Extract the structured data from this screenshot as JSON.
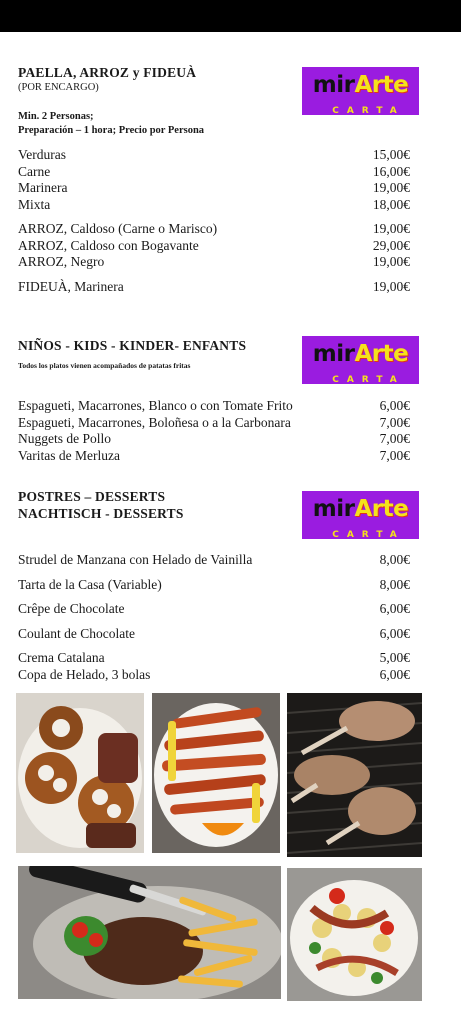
{
  "paella": {
    "title": "PAELLA,  ARROZ y FIDEUÀ",
    "subtitle": "(POR ENCARGO)",
    "note1": "Min. 2 Personas;",
    "note2": "Preparación – 1 hora; Precio por Persona",
    "items": [
      {
        "name": "Verduras",
        "price": "15,00€"
      },
      {
        "name": "Carne",
        "price": "16,00€"
      },
      {
        "name": "Marinera",
        "price": "19,00€"
      },
      {
        "name": "Mixta",
        "price": "18,00€"
      },
      {
        "name": "ARROZ, Caldoso (Carne o Marisco)",
        "price": "19,00€"
      },
      {
        "name": "ARROZ, Caldoso con Bogavante",
        "price": "29,00€"
      },
      {
        "name": "ARROZ, Negro",
        "price": "19,00€"
      },
      {
        "name": "FIDEUÀ, Marinera",
        "price": "19,00€"
      }
    ]
  },
  "kids": {
    "title": "NIÑOS - KIDS - KINDER- ENFANTS",
    "note": "Todos los platos vienen acompañados de patatas fritas",
    "items": [
      {
        "name": "Espagueti, Macarrones, Blanco o con Tomate Frito",
        "price": "6,00€"
      },
      {
        "name": "Espagueti, Macarrones, Boloñesa o a la Carbonara",
        "price": "7,00€"
      },
      {
        "name": "Nuggets de Pollo",
        "price": "7,00€"
      },
      {
        "name": "Varitas de Merluza",
        "price": "7,00€"
      }
    ]
  },
  "desserts": {
    "title1": "POSTRES – DESSERTS",
    "title2": "NACHTISCH - DESSERTS",
    "items": [
      {
        "name": "Strudel de Manzana con Helado de Vainilla",
        "price": "8,00€"
      },
      {
        "name": "Tarta de la Casa (Variable)",
        "price": "8,00€"
      },
      {
        "name": "Crêpe de Chocolate",
        "price": "6,00€"
      },
      {
        "name": "Coulant de Chocolate",
        "price": "6,00€"
      },
      {
        "name": "Crema Catalana",
        "price": "5,00€"
      },
      {
        "name": "Copa de Helado, 3 bolas",
        "price": "6,00€"
      }
    ]
  },
  "logo": {
    "part1": "mir",
    "part2": "Arte",
    "tagline": "CARTA"
  },
  "colors": {
    "logo_bg": "#9a1ce0",
    "logo_accent": "#f5e21c",
    "topbar": "#000000"
  }
}
